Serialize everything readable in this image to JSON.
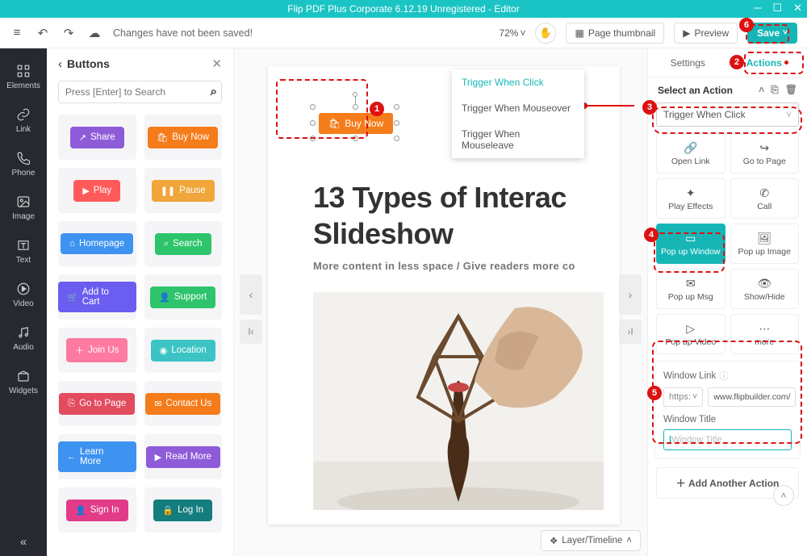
{
  "title": "Flip PDF Plus Corporate 6.12.19 Unregistered - Editor",
  "window": {
    "min": "─",
    "max": "☐",
    "close": "✕"
  },
  "toolbar": {
    "unsaved": "Changes have not been saved!",
    "zoom": "72%",
    "pagethumb": "Page thumbnail",
    "preview": "Preview",
    "save": "Save"
  },
  "leftnav": [
    {
      "label": "Elements"
    },
    {
      "label": "Link"
    },
    {
      "label": "Phone"
    },
    {
      "label": "Image"
    },
    {
      "label": "Text"
    },
    {
      "label": "Video"
    },
    {
      "label": "Audio"
    },
    {
      "label": "Widgets"
    }
  ],
  "panel": {
    "title": "Buttons",
    "search_placeholder": "Press [Enter] to Search",
    "chips": [
      {
        "label": "Share",
        "bg": "#8e5cd9",
        "icon": "↗"
      },
      {
        "label": "Buy Now",
        "bg": "#f57c1a",
        "icon": "🛍"
      },
      {
        "label": "Play",
        "bg": "#ff5a5a",
        "icon": "▶"
      },
      {
        "label": "Pause",
        "bg": "#f0a63a",
        "icon": "❚❚"
      },
      {
        "label": "Homepage",
        "bg": "#3e93f0",
        "icon": "⌂"
      },
      {
        "label": "Search",
        "bg": "#2ec46c",
        "icon": "⌕"
      },
      {
        "label": "Add to Cart",
        "bg": "#6a5df0",
        "icon": "🛒"
      },
      {
        "label": "Support",
        "bg": "#2ec46c",
        "icon": "👤"
      },
      {
        "label": "Join Us",
        "bg": "#ff7aa0",
        "icon": "＋"
      },
      {
        "label": "Location",
        "bg": "#3cc4c4",
        "icon": "◉"
      },
      {
        "label": "Go to Page",
        "bg": "#e34b5e",
        "icon": "⎘"
      },
      {
        "label": "Contact Us",
        "bg": "#f57c1a",
        "icon": "✉"
      },
      {
        "label": "Learn More",
        "bg": "#3e93f0",
        "icon": "←"
      },
      {
        "label": "Read More",
        "bg": "#8e5cd9",
        "icon": "▶"
      },
      {
        "label": "Sign In",
        "bg": "#e23b88",
        "icon": "👤"
      },
      {
        "label": "Log In",
        "bg": "#147d7d",
        "icon": "🔒"
      }
    ]
  },
  "canvas": {
    "selbtn": "Buy Now",
    "selicon": "🛍",
    "h1a": "13 Types of Interac",
    "h1b": "Slideshow",
    "sub": "More content in less space / Give readers more co",
    "layer": "Layer/Timeline"
  },
  "trigger": {
    "items": [
      "Trigger When Click",
      "Trigger When Mouseover",
      "Trigger When Mouseleave"
    ]
  },
  "right": {
    "tab1": "Settings",
    "tab2": "Actions",
    "section": "Select an Action",
    "select": "Trigger When Click",
    "actions": [
      {
        "label": "Open Link",
        "icon": "🔗"
      },
      {
        "label": "Go to Page",
        "icon": "↪"
      },
      {
        "label": "Play Effects",
        "icon": "✦"
      },
      {
        "label": "Call",
        "icon": "✆"
      },
      {
        "label": "Pop up Window",
        "icon": "▭",
        "active": true
      },
      {
        "label": "Pop up Image",
        "icon": "🖼"
      },
      {
        "label": "Pop up Msg",
        "icon": "✉"
      },
      {
        "label": "Show/Hide",
        "icon": "👁"
      },
      {
        "label": "Pop up Video",
        "icon": "▷"
      },
      {
        "label": "more",
        "icon": "⋯"
      }
    ],
    "wlink_label": "Window Link",
    "proto": "https:",
    "url": "www.flipbuilder.com/",
    "wtitle_label": "Window Title",
    "wtitle_placeholder": "Window Title",
    "add": "Add Another Action"
  }
}
